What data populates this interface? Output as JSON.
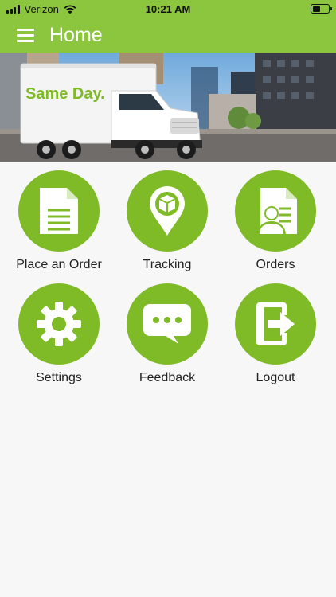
{
  "status": {
    "carrier": "Verizon",
    "time": "10:21 AM"
  },
  "header": {
    "title": "Home"
  },
  "hero": {
    "truck_logo": "Same Day."
  },
  "menu": [
    {
      "label": "Place an Order",
      "icon": "document-icon"
    },
    {
      "label": "Tracking",
      "icon": "location-pin-box-icon"
    },
    {
      "label": "Orders",
      "icon": "user-document-icon"
    },
    {
      "label": "Settings",
      "icon": "gear-icon"
    },
    {
      "label": "Feedback",
      "icon": "chat-bubble-icon"
    },
    {
      "label": "Logout",
      "icon": "logout-arrow-icon"
    }
  ],
  "colors": {
    "brand_green": "#8cc63f",
    "tile_green": "#7fba27"
  }
}
